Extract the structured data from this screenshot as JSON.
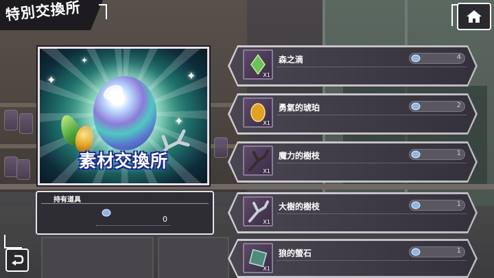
{
  "header": {
    "title": "特別交換所"
  },
  "promo": {
    "title": "素材交換所"
  },
  "owned": {
    "label": "持有道具",
    "count": "0"
  },
  "items": [
    {
      "name": "森之滴",
      "qty": "X1",
      "cost": "4",
      "icon": "green-gem-icon"
    },
    {
      "name": "勇氣的琥珀",
      "qty": "X1",
      "cost": "2",
      "icon": "amber-icon"
    },
    {
      "name": "魔力的樹枝",
      "qty": "X1",
      "cost": "1",
      "icon": "magic-branch-icon"
    },
    {
      "name": "大樹的樹枝",
      "qty": "X1",
      "cost": "1",
      "icon": "great-tree-branch-icon"
    },
    {
      "name": "狼的螢石",
      "qty": "X1",
      "cost": "1",
      "icon": "wolf-fluorite-icon"
    }
  ],
  "colors": {
    "accent": "#e6e2e9",
    "row_dark": "#34313a",
    "banner": "#1d1b1f"
  }
}
